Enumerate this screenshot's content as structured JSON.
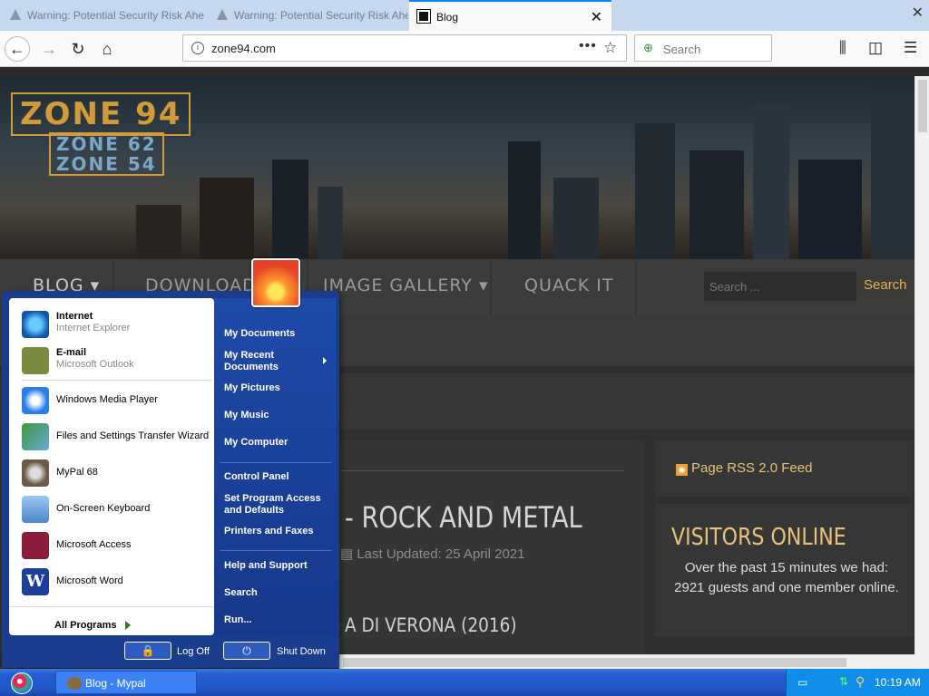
{
  "browser": {
    "tabs": [
      {
        "label": "Warning: Potential Security Risk Ahead",
        "active": false
      },
      {
        "label": "Warning: Potential Security Risk Ahead",
        "active": false
      },
      {
        "label": "Blog",
        "active": true
      }
    ],
    "window_close": "✕",
    "url": "zone94.com",
    "search_placeholder": "Search"
  },
  "site": {
    "logo_main": "ZONE 94",
    "logo_sub1": "ZONE 62",
    "logo_sub2": "ZONE 54",
    "menu": [
      {
        "label": "BLOG",
        "has_dropdown": true
      },
      {
        "label": "DOWNLOADS",
        "has_dropdown": true
      },
      {
        "label": "IMAGE GALLERY",
        "has_dropdown": true
      },
      {
        "label": "QUACK IT",
        "has_dropdown": false
      }
    ],
    "search_placeholder": "Search ...",
    "search_button": "Search",
    "article_title": "- ROCK AND METAL",
    "article_updated": "Last Updated: 25 April 2021",
    "article_subtitle": "A DI VERONA (2016)",
    "rss_label": "Page RSS 2.0 Feed",
    "visitors_title": "VISITORS ONLINE",
    "visitors_text": "Over the past 15 minutes we had: 2921 guests and one member online."
  },
  "start_menu": {
    "pinned": [
      {
        "name": "Internet",
        "sub": "Internet Explorer",
        "icon": "internet-explorer-icon"
      },
      {
        "name": "E-mail",
        "sub": "Microsoft Outlook",
        "icon": "outlook-icon"
      }
    ],
    "recent": [
      {
        "name": "Windows Media Player",
        "icon": "media-player-icon"
      },
      {
        "name": "Files and Settings Transfer Wizard",
        "icon": "transfer-wizard-icon"
      },
      {
        "name": "MyPal 68",
        "icon": "mypal-icon"
      },
      {
        "name": "On-Screen Keyboard",
        "icon": "keyboard-icon"
      },
      {
        "name": "Microsoft Access",
        "icon": "access-icon"
      },
      {
        "name": "Microsoft Word",
        "icon": "word-icon"
      }
    ],
    "all_programs": "All Programs",
    "right_items": [
      "My Documents",
      "My Recent Documents",
      "My Pictures",
      "My Music",
      "My Computer",
      "Control Panel",
      "Set Program Access and Defaults",
      "Printers and Faxes",
      "Help and Support",
      "Search",
      "Run..."
    ],
    "log_off": "Log Off",
    "shut_down": "Shut Down"
  },
  "taskbar": {
    "task": "Blog - Mypal",
    "clock": "10:19 AM"
  }
}
